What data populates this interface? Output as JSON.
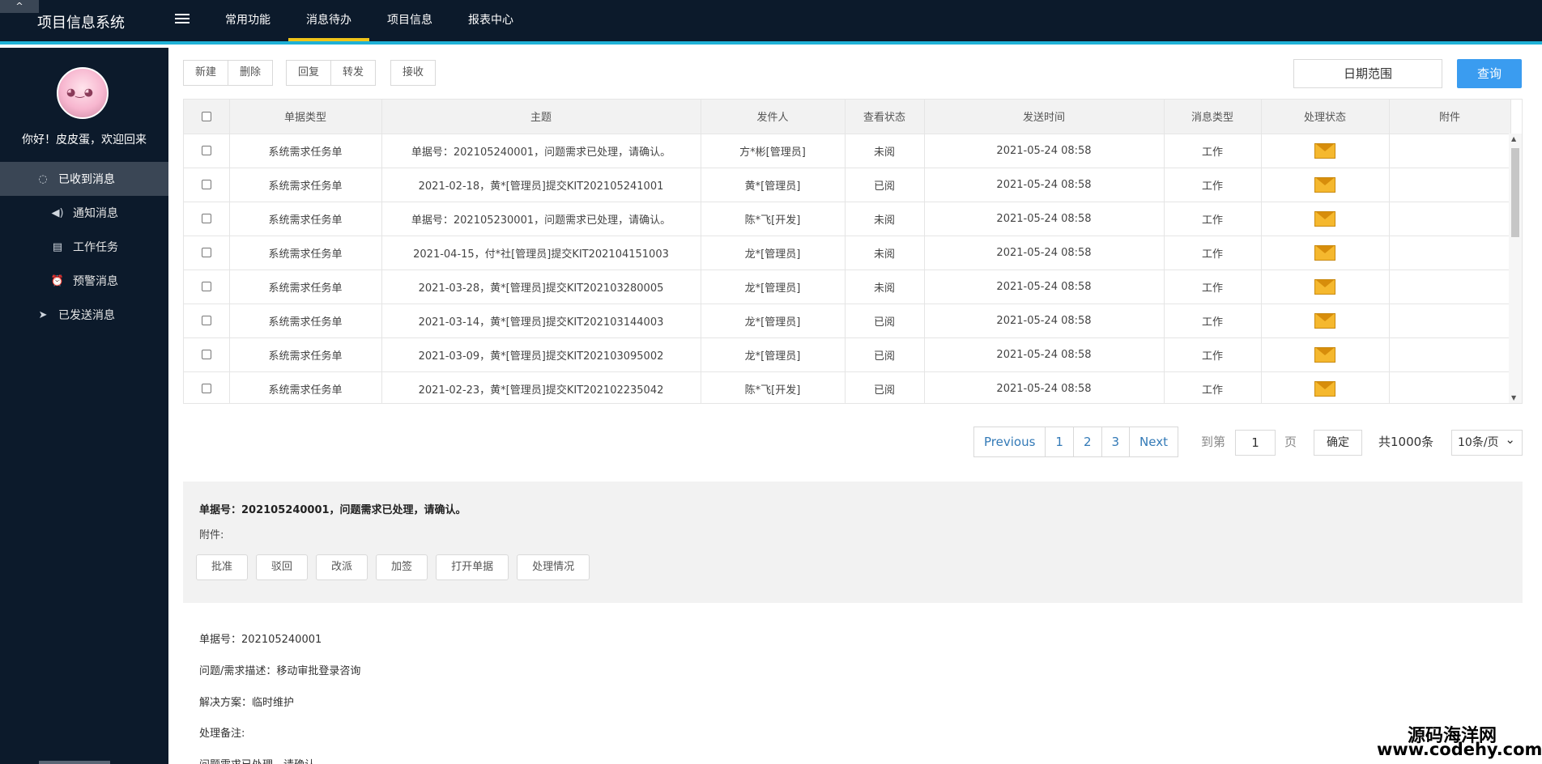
{
  "header": {
    "collapse_glyph": "^",
    "app_title": "项目信息系统",
    "nav": [
      "常用功能",
      "消息待办",
      "项目信息",
      "报表中心"
    ]
  },
  "sidebar": {
    "greeting": "你好！皮皮蛋，欢迎回来",
    "items": [
      {
        "label": "已收到消息",
        "icon": "chat-bubble-icon"
      },
      {
        "label": "通知消息",
        "icon": "speaker-icon"
      },
      {
        "label": "工作任务",
        "icon": "clipboard-icon"
      },
      {
        "label": "预警消息",
        "icon": "alarm-icon"
      },
      {
        "label": "已发送消息",
        "icon": "send-icon"
      }
    ]
  },
  "toolbar": {
    "new": "新建",
    "delete": "删除",
    "reply": "回复",
    "forward": "转发",
    "receive": "接收",
    "date_range": "日期范围",
    "query": "查询"
  },
  "table": {
    "headers": [
      "单据类型",
      "主题",
      "发件人",
      "查看状态",
      "发送时间",
      "消息类型",
      "处理状态",
      "附件"
    ],
    "rows": [
      {
        "type": "系统需求任务单",
        "subject": "单据号：202105240001，问题需求已处理，请确认。",
        "sender": "方*彬[管理员]",
        "view": "未阅",
        "time": "2021-05-24 08:58",
        "msg": "工作"
      },
      {
        "type": "系统需求任务单",
        "subject": "2021-02-18，黄*[管理员]提交KIT202105241001",
        "sender": "黄*[管理员]",
        "view": "已阅",
        "time": "2021-05-24 08:58",
        "msg": "工作"
      },
      {
        "type": "系统需求任务单",
        "subject": "单据号：202105230001，问题需求已处理，请确认。",
        "sender": "陈*飞[开发]",
        "view": "未阅",
        "time": "2021-05-24 08:58",
        "msg": "工作"
      },
      {
        "type": "系统需求任务单",
        "subject": "2021-04-15，付*社[管理员]提交KIT202104151003",
        "sender": "龙*[管理员]",
        "view": "未阅",
        "time": "2021-05-24 08:58",
        "msg": "工作"
      },
      {
        "type": "系统需求任务单",
        "subject": "2021-03-28，黄*[管理员]提交KIT202103280005",
        "sender": "龙*[管理员]",
        "view": "未阅",
        "time": "2021-05-24 08:58",
        "msg": "工作"
      },
      {
        "type": "系统需求任务单",
        "subject": "2021-03-14，黄*[管理员]提交KIT202103144003",
        "sender": "龙*[管理员]",
        "view": "已阅",
        "time": "2021-05-24 08:58",
        "msg": "工作"
      },
      {
        "type": "系统需求任务单",
        "subject": "2021-03-09，黄*[管理员]提交KIT202103095002",
        "sender": "龙*[管理员]",
        "view": "已阅",
        "time": "2021-05-24 08:58",
        "msg": "工作"
      },
      {
        "type": "系统需求任务单",
        "subject": "2021-02-23，黄*[管理员]提交KIT202102235042",
        "sender": "陈*飞[开发]",
        "view": "已阅",
        "time": "2021-05-24 08:58",
        "msg": "工作"
      }
    ]
  },
  "pagination": {
    "previous": "Previous",
    "pages": [
      "1",
      "2",
      "3"
    ],
    "next": "Next",
    "goto_label": "到第",
    "goto_value": "1",
    "goto_suffix": "页",
    "confirm": "确定",
    "total": "共1000条",
    "per_page": "10条/页"
  },
  "detail": {
    "title": "单据号：202105240001，问题需求已处理，请确认。",
    "attachment_label": "附件:",
    "actions": [
      "批准",
      "驳回",
      "改派",
      "加签",
      "打开单据",
      "处理情况"
    ],
    "doc_no": "单据号：202105240001",
    "description": "问题/需求描述：移动审批登录咨询",
    "solution": "解决方案：临时维护",
    "remark": "处理备注:",
    "confirm_text": "问题需求已处理，请确认。"
  },
  "watermark": {
    "line1": "源码海洋网",
    "line2": "www.codehy.com"
  },
  "colors": {
    "topbar": "#0c1a2b",
    "accent": "#1fb1d6",
    "nav_active": "#f0c419",
    "primary_button": "#3a9cf0",
    "link": "#337ab7"
  }
}
